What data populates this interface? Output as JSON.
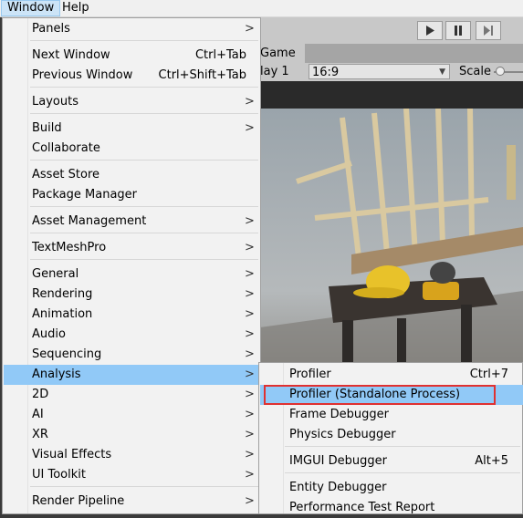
{
  "menubar": {
    "window": "Window",
    "help": "Help"
  },
  "editor": {
    "play_icon": "play-icon",
    "pause_icon": "pause-icon",
    "step_icon": "step-icon",
    "game_tab": "Game",
    "display": "lay 1",
    "aspect": "16:9",
    "scale_label": "Scale"
  },
  "window_menu": {
    "items": [
      {
        "label": "Panels",
        "submenu": true
      },
      {
        "label": "Next Window",
        "shortcut": "Ctrl+Tab"
      },
      {
        "label": "Previous Window",
        "shortcut": "Ctrl+Shift+Tab"
      },
      {
        "label": "Layouts",
        "submenu": true
      },
      {
        "label": "Build",
        "submenu": true
      },
      {
        "label": "Collaborate"
      },
      {
        "label": "Asset Store"
      },
      {
        "label": "Package Manager"
      },
      {
        "label": "Asset Management",
        "submenu": true
      },
      {
        "label": "TextMeshPro",
        "submenu": true
      },
      {
        "label": "General",
        "submenu": true
      },
      {
        "label": "Rendering",
        "submenu": true
      },
      {
        "label": "Animation",
        "submenu": true
      },
      {
        "label": "Audio",
        "submenu": true
      },
      {
        "label": "Sequencing",
        "submenu": true
      },
      {
        "label": "Analysis",
        "submenu": true,
        "active": true
      },
      {
        "label": "2D",
        "submenu": true
      },
      {
        "label": "AI",
        "submenu": true
      },
      {
        "label": "XR",
        "submenu": true
      },
      {
        "label": "Visual Effects",
        "submenu": true
      },
      {
        "label": "UI Toolkit",
        "submenu": true
      },
      {
        "label": "Render Pipeline",
        "submenu": true
      }
    ],
    "arrow": ">"
  },
  "analysis_submenu": {
    "items": [
      {
        "label": "Profiler",
        "shortcut": "Ctrl+7"
      },
      {
        "label": "Profiler (Standalone Process)",
        "highlighted": true
      },
      {
        "label": "Frame Debugger"
      },
      {
        "label": "Physics Debugger"
      },
      {
        "label": "IMGUI Debugger",
        "shortcut": "Alt+5"
      },
      {
        "label": "Entity Debugger"
      },
      {
        "label": "Performance Test Report"
      }
    ]
  },
  "colors": {
    "highlight": "#91c9f7",
    "annotation": "#e03131"
  }
}
